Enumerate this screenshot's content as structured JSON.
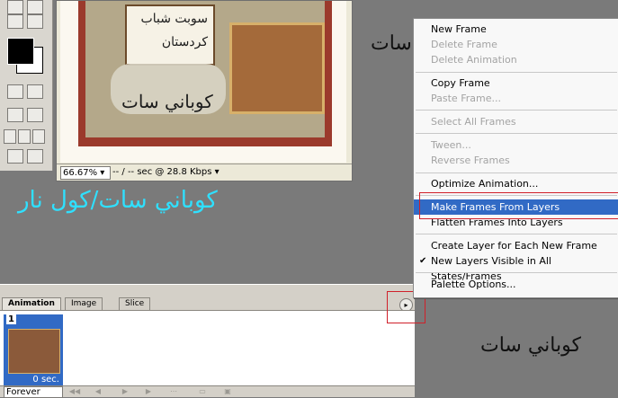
{
  "document": {
    "zoom": "66.67% ▾",
    "speed": "-- / -- sec @ 28.8 Kbps ▾",
    "card_line1": "سوبت شباب",
    "card_line2": "كردستان",
    "watermark": "كوباني سات"
  },
  "watermarks": {
    "top_right": "كوباني سات",
    "bottom_right": "كوباني سات"
  },
  "desktop_text": "كوباني سات/كول نار",
  "animation_panel": {
    "tabs": [
      "Animation",
      "Image Map",
      "Slice"
    ],
    "frame_number": "1",
    "frame_delay": "0 sec.",
    "loop": "Forever",
    "panel_menu_glyph": "▸"
  },
  "context_menu": {
    "items": [
      {
        "label": "New Frame",
        "state": "enabled"
      },
      {
        "label": "Delete Frame",
        "state": "disabled"
      },
      {
        "label": "Delete Animation",
        "state": "disabled"
      },
      {
        "label": "Copy Frame",
        "state": "enabled"
      },
      {
        "label": "Paste Frame...",
        "state": "disabled"
      },
      {
        "label": "Select All Frames",
        "state": "disabled"
      },
      {
        "label": "Tween...",
        "state": "disabled"
      },
      {
        "label": "Reverse Frames",
        "state": "disabled"
      },
      {
        "label": "Optimize Animation...",
        "state": "enabled"
      },
      {
        "label": "Make Frames From Layers",
        "state": "selected"
      },
      {
        "label": "Flatten Frames Into Layers",
        "state": "enabled"
      },
      {
        "label": "Create Layer for Each New Frame",
        "state": "enabled"
      },
      {
        "label": "New Layers Visible in All States/Frames",
        "state": "checked"
      },
      {
        "label": "Palette Options...",
        "state": "enabled"
      }
    ],
    "check_glyph": "✔"
  },
  "colors": {
    "desktop": "#7a7a7a",
    "menu_highlight": "#316ac5",
    "annotation_red": "#d0202a",
    "desktop_text": "#2fe0ff"
  }
}
